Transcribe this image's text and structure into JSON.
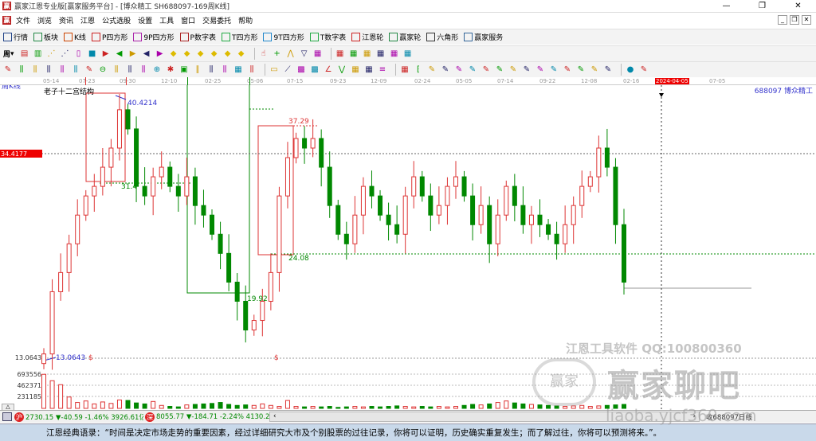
{
  "window": {
    "title": "赢家江恩专业版[赢家服务平台] - [博众精工  SH688097-169周K线]",
    "min": "—",
    "max": "❐",
    "close": "✕"
  },
  "menu": [
    "文件",
    "浏览",
    "资讯",
    "江恩",
    "公式选股",
    "设置",
    "工具",
    "窗口",
    "交易委托",
    "帮助"
  ],
  "mdi": [
    "_",
    "❐",
    "✕"
  ],
  "toolbar": [
    {
      "label": "行情",
      "icon": "grid-icon",
      "color": "#224488"
    },
    {
      "label": "板块",
      "icon": "blocks-icon",
      "color": "#228844"
    },
    {
      "label": "K线",
      "icon": "candles-icon",
      "color": "#cc4400"
    },
    {
      "label": "P四方形",
      "icon": "P",
      "color": "#cc2222"
    },
    {
      "label": "9P四方形",
      "icon": "9",
      "color": "#aa22aa"
    },
    {
      "label": "P数字表",
      "icon": "PN",
      "color": "#aa2222"
    },
    {
      "label": "T四方形",
      "icon": "TS",
      "color": "#22aa44"
    },
    {
      "label": "9T四方形",
      "icon": "T9",
      "color": "#2288cc"
    },
    {
      "label": "T数字表",
      "icon": "TN",
      "color": "#22aa44"
    },
    {
      "label": "江恩轮",
      "icon": "◎",
      "color": "#cc2222"
    },
    {
      "label": "赢家轮",
      "icon": "◎",
      "color": "#228844"
    },
    {
      "label": "六角形",
      "icon": "✡",
      "color": "#333333"
    },
    {
      "label": "赢家服务",
      "icon": "▦",
      "color": "#336699"
    }
  ],
  "period_select": "周",
  "axis_dates": [
    "05-14",
    "07-23",
    "09-30",
    "12-10",
    "02-25",
    "05-06",
    "07-15",
    "09-23",
    "12-09",
    "02-24",
    "05-05",
    "07-14",
    "09-22",
    "12-08",
    "02-16",
    "2024-04-05",
    "07-05"
  ],
  "chart_header": {
    "period": "周K线",
    "indicator": "老子十二宫结构",
    "stock": "688097  博众精工"
  },
  "chart_data": {
    "type": "candlestick",
    "ylim": [
      11,
      43
    ],
    "closes": [
      13.5,
      20,
      22,
      25,
      28,
      30,
      31,
      33,
      35,
      39,
      37,
      31,
      30,
      32,
      33,
      31,
      30,
      32,
      29,
      28,
      26,
      24,
      21,
      19,
      16,
      17,
      19,
      22,
      30,
      34,
      36,
      35,
      36,
      33,
      29,
      26,
      25,
      28,
      31,
      30,
      28,
      27,
      26,
      30,
      32,
      30,
      28,
      29,
      31,
      32,
      30,
      27,
      29,
      25,
      28,
      31,
      29,
      27,
      28,
      27,
      26,
      25,
      27,
      29,
      31,
      32,
      35,
      33,
      27,
      21
    ],
    "volumes": [
      690000,
      560000,
      480000,
      230000,
      120000,
      150000,
      90000,
      130000,
      100000,
      170000,
      160000,
      110000,
      90000,
      140000,
      60000,
      40000,
      30000,
      70000,
      80000,
      90000,
      100000,
      120000,
      80000,
      60000,
      70000,
      60000,
      90000,
      60000,
      40000,
      160000,
      40000,
      30000,
      40000,
      30000,
      40000,
      20000,
      30000,
      40000,
      30000,
      40000,
      30000,
      40000,
      50000,
      40000,
      30000,
      40000,
      30000,
      40000,
      30000,
      40000,
      60000,
      80000,
      70000,
      90000,
      120000,
      150000,
      110000,
      90000,
      80000,
      70000,
      60000,
      50000,
      40000,
      50000,
      60000,
      40000,
      50000,
      60000,
      70000,
      80000
    ],
    "price_labels": {
      "current": "34.4177",
      "high": "40.4214",
      "box_high": "37.29",
      "mid": "31.4",
      "box_low": "24.08",
      "low_mark": "19.92",
      "bottom": "13.0643",
      "bottom_left": "13.0643",
      "dollar1": "$",
      "dollar2": "$"
    },
    "volume_ticks": [
      "693556",
      "462371",
      "231185"
    ]
  },
  "status": {
    "sh_badge": "沪",
    "sh": "2730.15 ▼-40.59 -1.46% 3926.61亿",
    "sz_badge": "深",
    "sz": "8055.77 ▼-184.71 -2.24% 4130.26",
    "right": "收688097日线",
    "tri": "△"
  },
  "watermark": {
    "line1": "江恩工具软件  QQ:100800360",
    "logo": "赢家聊吧",
    "url": "liaoba.yjcf360.com",
    "seal": "赢家"
  },
  "quote": "江恩经典语录：“时间是决定市场走势的重要因素，经过详细研究大市及个别股票的过往记录，你将可以证明，历史确实重复发生；而了解过往，你将可以预测将来。”。"
}
